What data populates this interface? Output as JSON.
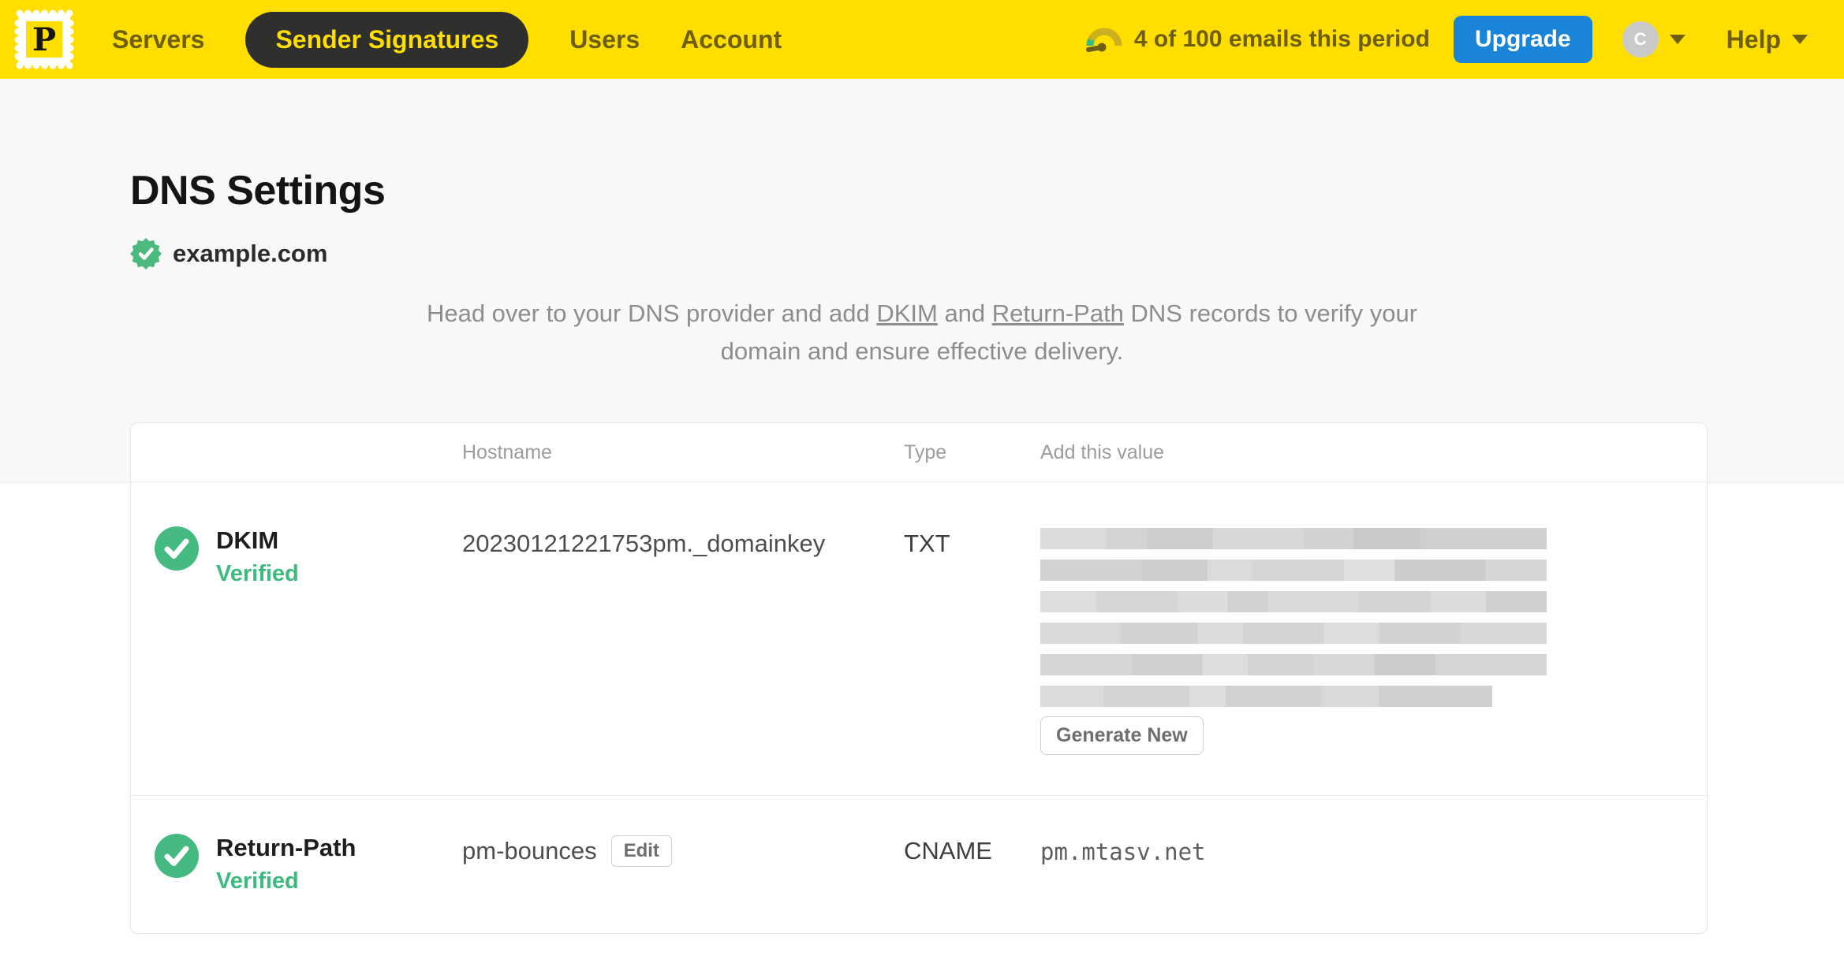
{
  "nav": {
    "logo_letter": "P",
    "items": [
      {
        "label": "Servers",
        "active": false
      },
      {
        "label": "Sender Signatures",
        "active": true
      },
      {
        "label": "Users",
        "active": false
      },
      {
        "label": "Account",
        "active": false
      }
    ],
    "usage_text": "4 of 100 emails this period",
    "upgrade_label": "Upgrade",
    "avatar_letter": "C",
    "help_label": "Help"
  },
  "page": {
    "title": "DNS Settings",
    "domain": "example.com",
    "description": {
      "part1": "Head over to your DNS provider and add ",
      "dkim_link": "DKIM",
      "part2": " and ",
      "return_path_link": "Return-Path",
      "part3": " DNS records to verify your domain and ensure effective delivery."
    }
  },
  "table": {
    "headers": {
      "hostname": "Hostname",
      "type": "Type",
      "value": "Add this value"
    },
    "dkim_row": {
      "name": "DKIM",
      "status": "Verified",
      "hostname": "20230121221753pm._domainkey",
      "type": "TXT",
      "value_note": "redacted",
      "action_label": "Generate New"
    },
    "return_path_row": {
      "name": "Return-Path",
      "status": "Verified",
      "hostname": "pm-bounces",
      "edit_label": "Edit",
      "type": "CNAME",
      "value": "pm.mtasv.net"
    }
  },
  "colors": {
    "brand_yellow": "#FFDE00",
    "nav_pill_dark": "#2F2F2E",
    "nav_text_olive": "#6E5E0F",
    "upgrade_blue": "#1984D8",
    "success_green": "#45BA80",
    "redaction_gray": "#D5D5D5"
  }
}
